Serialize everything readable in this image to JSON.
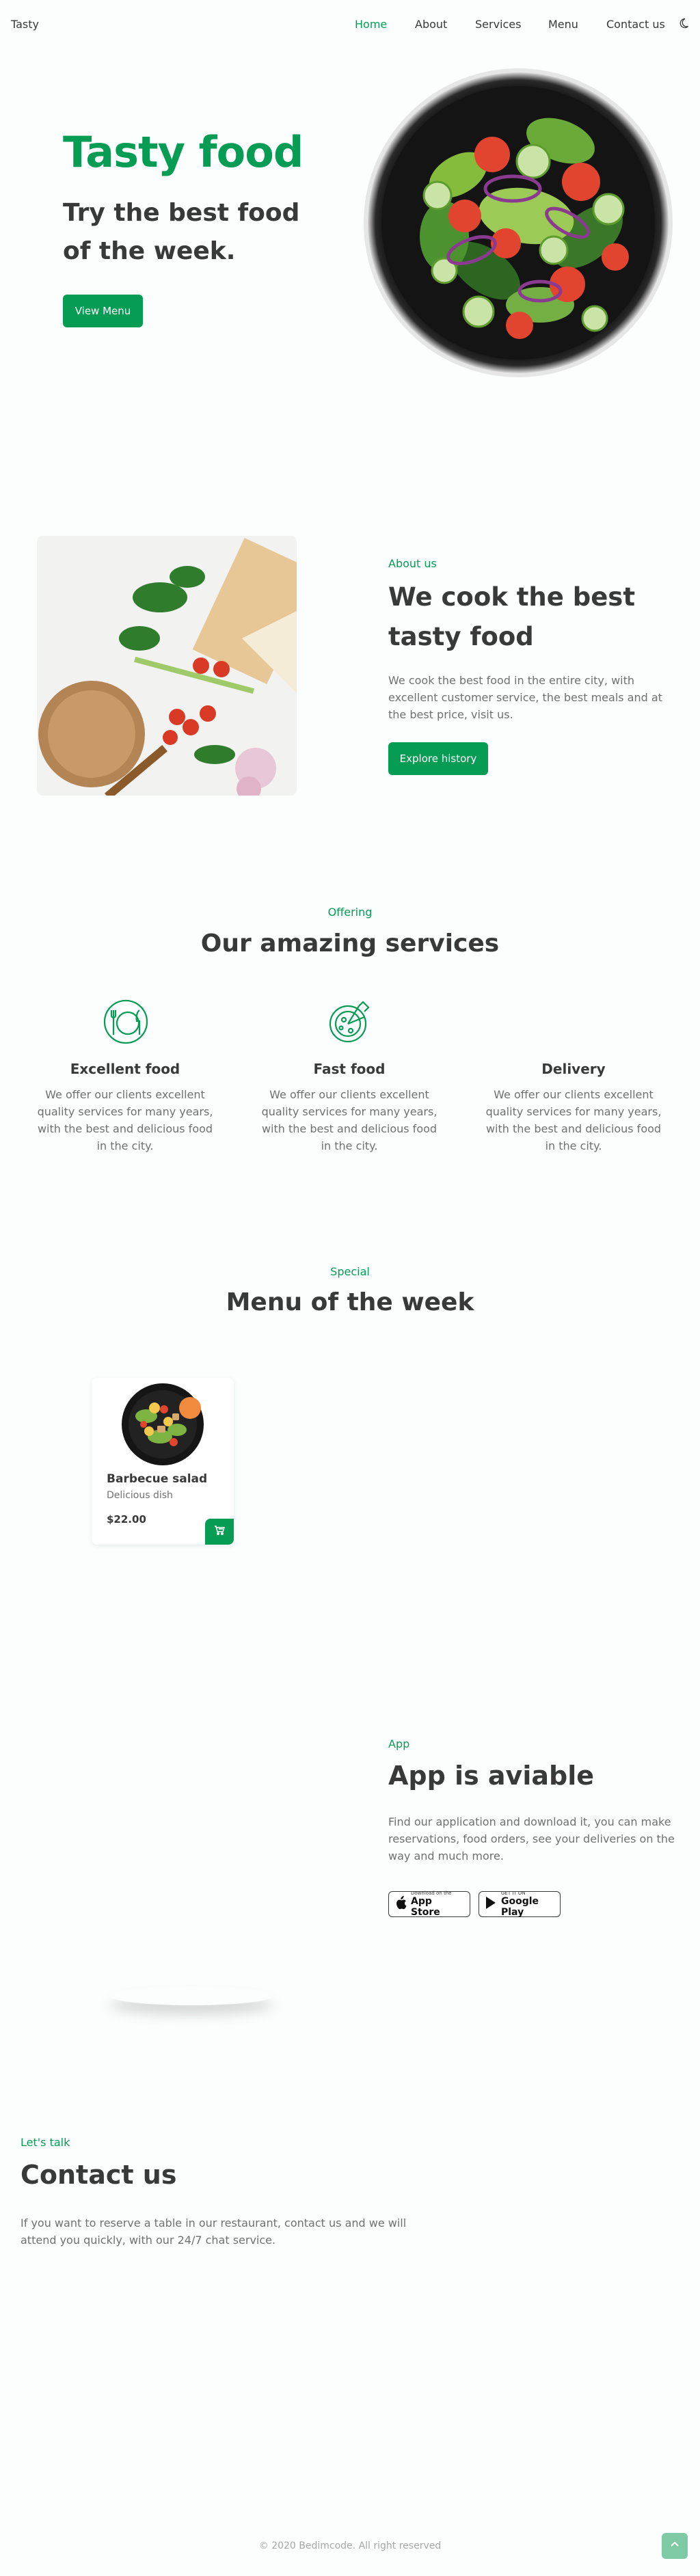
{
  "nav": {
    "logo": "Tasty",
    "items": [
      "Home",
      "About",
      "Services",
      "Menu",
      "Contact us"
    ],
    "theme_icon": "moon-icon",
    "active": "Home"
  },
  "hero": {
    "title": "Tasty food",
    "subtitle": "Try the best food of the week.",
    "button": "View Menu"
  },
  "about": {
    "kicker": "About us",
    "title": "We cook the best tasty food",
    "text": "We cook the best food in the entire city, with excellent customer service, the best meals and at the best price, visit us.",
    "button": "Explore history"
  },
  "services": {
    "kicker": "Offering",
    "title": "Our amazing services",
    "items": [
      {
        "icon": "plate-cutlery-icon",
        "name": "Excellent food",
        "text": "We offer our clients excellent quality services for many years, with the best and delicious food in the city."
      },
      {
        "icon": "pizza-icon",
        "name": "Fast food",
        "text": "We offer our clients excellent quality services for many years, with the best and delicious food in the city."
      },
      {
        "icon": "delivery-icon",
        "name": "Delivery",
        "text": "We offer our clients excellent quality services for many years, with the best and delicious food in the city."
      }
    ]
  },
  "menu": {
    "kicker": "Special",
    "title": "Menu of the week",
    "cards": [
      {
        "name": "Barbecue salad",
        "desc": "Delicious dish",
        "price": "$22.00",
        "icon": "cart-icon"
      }
    ]
  },
  "app": {
    "kicker": "App",
    "title": "App is aviable",
    "text": "Find our application and download it, you can make reservations, food orders, see your deliveries on the way and much more.",
    "appstore_small": "Download on the",
    "appstore_big": "App Store",
    "googleplay_small": "GET IT ON",
    "googleplay_big": "Google Play"
  },
  "contact": {
    "kicker": "Let's talk",
    "title": "Contact us",
    "text": "If you want to reserve a table in our restaurant, contact us and we will attend you quickly, with our 24/7 chat service."
  },
  "footer": {
    "text": "© 2020 Bedimcode. All right reserved",
    "scroll_icon": "arrow-up-icon"
  },
  "colors": {
    "accent": "#069c54",
    "text": "#393939",
    "muted": "#707070",
    "background": "#fbfefd"
  }
}
